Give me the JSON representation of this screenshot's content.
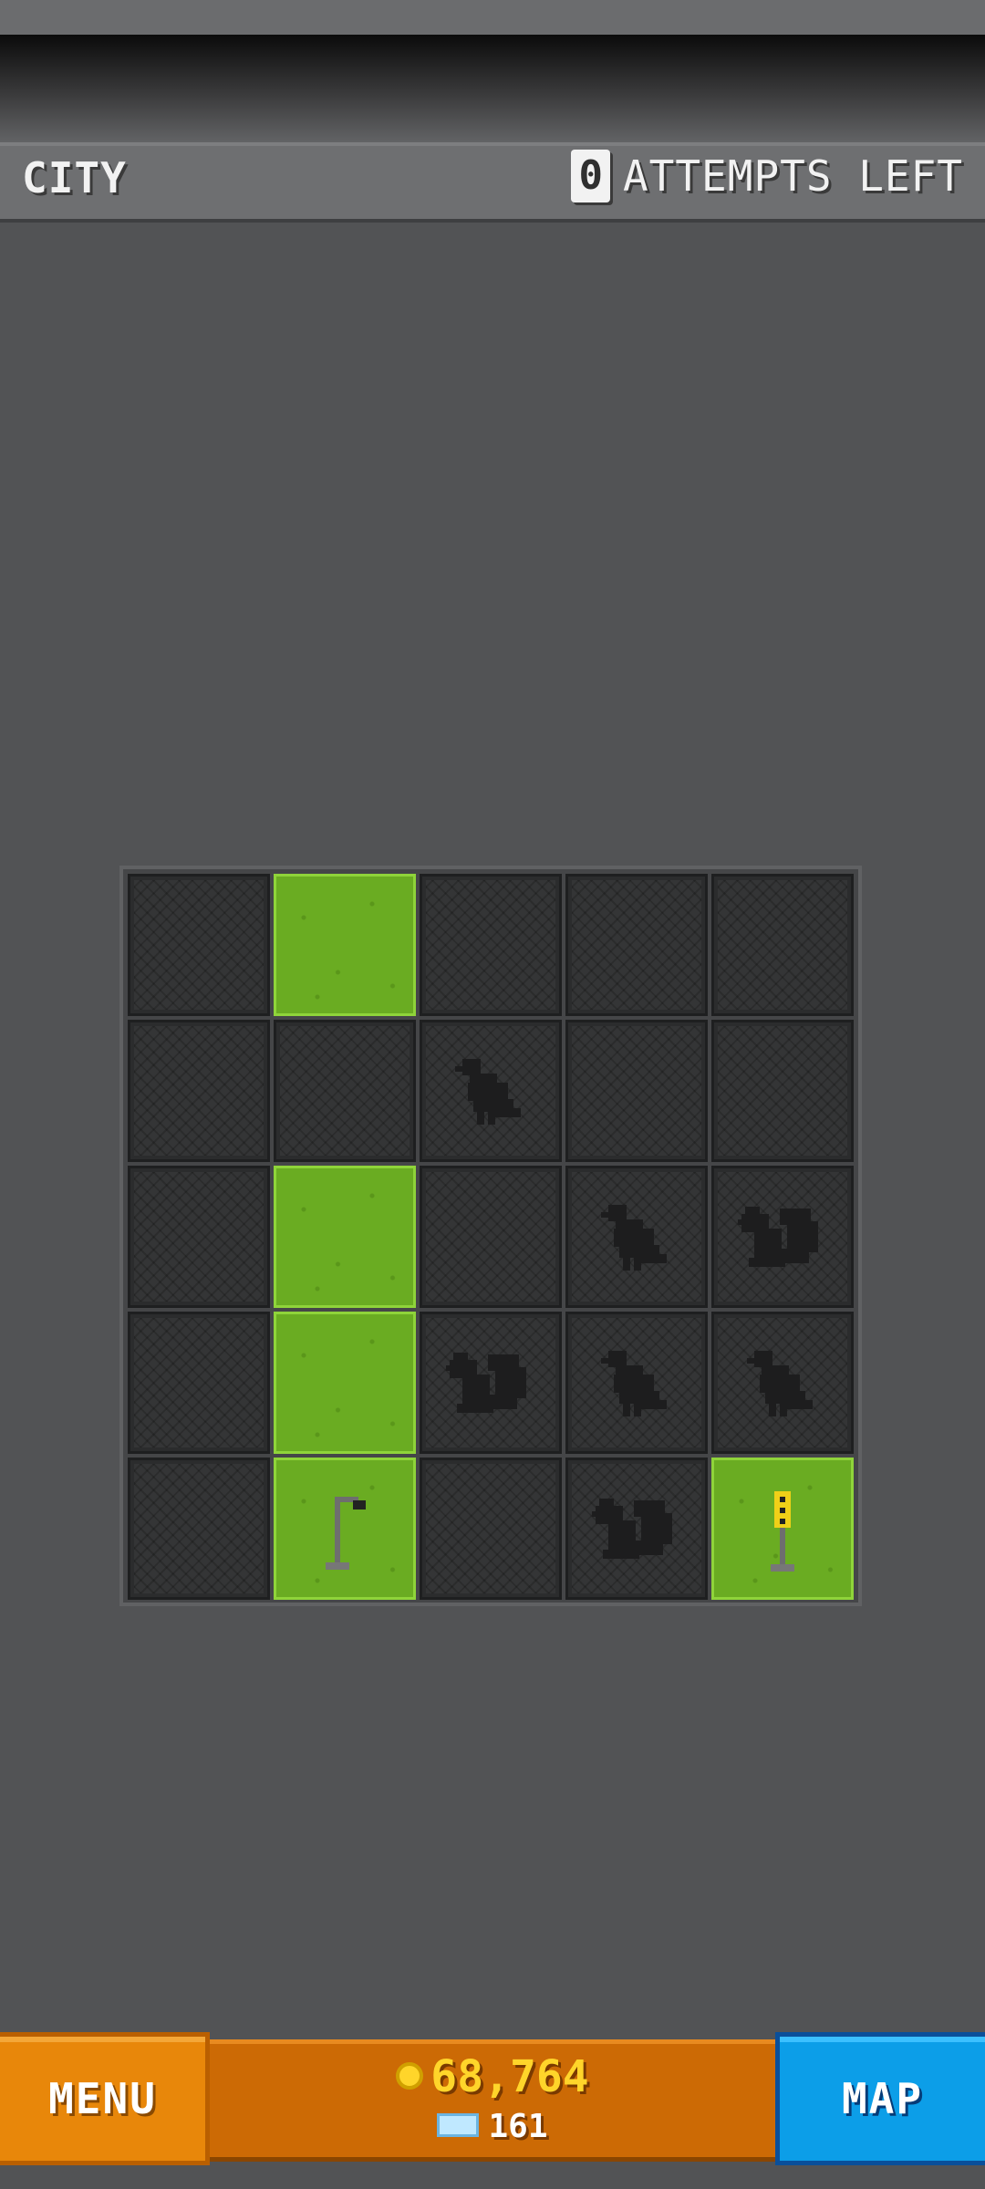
{
  "header": {
    "title": "CITY",
    "attempts_count": "0",
    "attempts_label": "ATTEMPTS LEFT"
  },
  "board": {
    "rows": [
      [
        {
          "state": "dark",
          "icon": null
        },
        {
          "state": "grass",
          "icon": null
        },
        {
          "state": "dark",
          "icon": null
        },
        {
          "state": "dark",
          "icon": null
        },
        {
          "state": "dark",
          "icon": null
        }
      ],
      [
        {
          "state": "dark",
          "icon": null
        },
        {
          "state": "dark",
          "icon": null
        },
        {
          "state": "dark",
          "icon": "pigeon-icon"
        },
        {
          "state": "dark",
          "icon": null
        },
        {
          "state": "dark",
          "icon": null
        }
      ],
      [
        {
          "state": "dark",
          "icon": null
        },
        {
          "state": "grass",
          "icon": null
        },
        {
          "state": "dark",
          "icon": null
        },
        {
          "state": "dark",
          "icon": "pigeon-icon"
        },
        {
          "state": "dark",
          "icon": "squirrel-icon"
        }
      ],
      [
        {
          "state": "dark",
          "icon": null
        },
        {
          "state": "grass",
          "icon": null
        },
        {
          "state": "dark",
          "icon": "squirrel-icon"
        },
        {
          "state": "dark",
          "icon": "pigeon-icon"
        },
        {
          "state": "dark",
          "icon": "pigeon-icon"
        }
      ],
      [
        {
          "state": "dark",
          "icon": null
        },
        {
          "state": "grass",
          "icon": "street-lamp-icon"
        },
        {
          "state": "dark",
          "icon": null
        },
        {
          "state": "dark",
          "icon": "squirrel-icon"
        },
        {
          "state": "grass",
          "icon": "traffic-light-icon"
        }
      ]
    ]
  },
  "footer": {
    "menu_label": "MENU",
    "coins": "68,764",
    "tickets": "161",
    "map_label": "MAP"
  },
  "colors": {
    "grass": "#6aac22",
    "tile_dark": "#343536",
    "menu_orange": "#e8870a",
    "map_blue": "#0c9ee8",
    "coin_yellow": "#ffd52a"
  }
}
